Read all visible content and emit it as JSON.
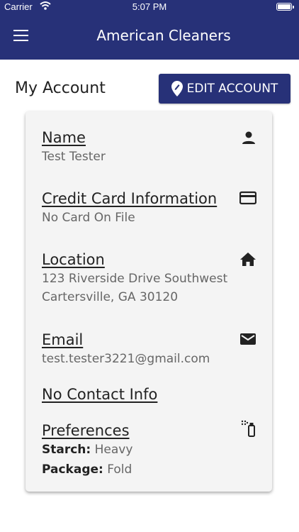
{
  "status_bar": {
    "carrier": "Carrier",
    "time": "5:07 PM"
  },
  "nav": {
    "title": "American Cleaners"
  },
  "page": {
    "title": "My Account",
    "edit_button": "EDIT ACCOUNT"
  },
  "account": {
    "name": {
      "label": "Name",
      "value": "Test Tester"
    },
    "card": {
      "label": "Credit Card Information",
      "value": "No Card On File"
    },
    "location": {
      "label": "Location",
      "line1": "123 Riverside Drive Southwest",
      "line2": "Cartersville, GA 30120"
    },
    "email": {
      "label": "Email",
      "value": "test.tester3221@gmail.com"
    },
    "contact": {
      "label": "No Contact Info"
    },
    "preferences": {
      "label": "Preferences",
      "starch_key": "Starch:",
      "starch_value": "Heavy",
      "package_key": "Package:",
      "package_value": "Fold"
    }
  },
  "colors": {
    "brand": "#273178",
    "card_bg": "#f4f4f4",
    "text_dark": "#222222",
    "text_muted": "#666666"
  },
  "icons": {
    "menu": "hamburger-icon",
    "edit": "location-pin-icon",
    "name": "person-icon",
    "card": "credit-card-icon",
    "location": "home-icon",
    "email": "envelope-icon",
    "preferences": "spray-bottle-icon"
  }
}
